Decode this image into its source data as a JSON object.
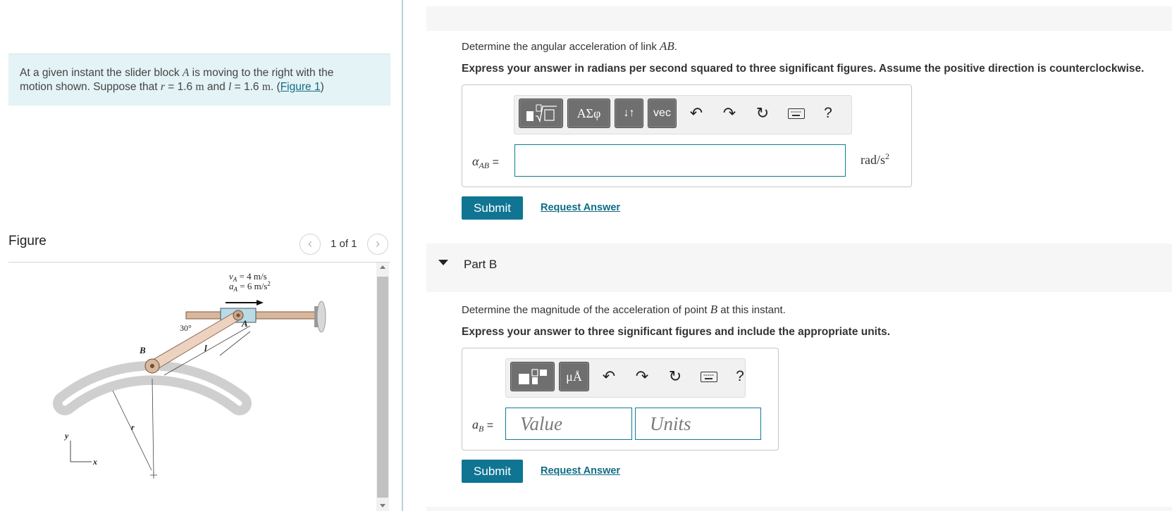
{
  "intro": {
    "text_before_A": "At a given instant the slider block ",
    "var_A": "A",
    "text_after_A": " is moving to the right with the",
    "line2_start": "motion shown. Suppose that ",
    "var_r": "r",
    "r_value": " = 1.6 ",
    "unit_m1": "m",
    "and_text": " and ",
    "var_l": "l",
    "l_value": " = 1.6 ",
    "unit_m2": "m",
    "period_paren": ". (",
    "figure_link": "Figure 1",
    "close_paren": ")"
  },
  "figure": {
    "title": "Figure",
    "counter": "1 of 1",
    "prev_icon": "chevron-left-icon",
    "next_icon": "chevron-right-icon",
    "labels": {
      "vA": "v",
      "vA_sub": "A",
      "vA_value": " = 4 m/s",
      "aA": "a",
      "aA_sub": "A",
      "aA_value": " = 6 m/s",
      "aA_exp": "2",
      "angle": "30°",
      "B": "B",
      "A": "A",
      "l": "l",
      "r": "r",
      "y": "y",
      "x": "x"
    }
  },
  "part_a": {
    "prompt_start": "Determine the angular acceleration of link ",
    "prompt_var": "AB",
    "prompt_end": ".",
    "instruction": "Express your answer in radians per second squared to three significant figures. Assume the positive direction is counterclockwise.",
    "toolbar": {
      "templates_icon": "fraction-sqrt-template-icon",
      "greek_label": "ΑΣφ",
      "arrows_label": "↓↑",
      "vec_label": "vec",
      "undo_icon": "undo-icon",
      "redo_icon": "redo-icon",
      "reset_icon": "reset-icon",
      "keyboard_icon": "keyboard-icon",
      "help_label": "?"
    },
    "var_symbol": "α",
    "var_sub": "AB",
    "equals": " =",
    "input_value": "",
    "unit": "rad/s",
    "unit_exp": "2",
    "submit_label": "Submit",
    "request_label": "Request Answer"
  },
  "part_b": {
    "header": "Part B",
    "caret_icon": "caret-down-icon",
    "prompt_start": "Determine the magnitude of the acceleration of point ",
    "prompt_var": "B",
    "prompt_end": " at this instant.",
    "instruction": "Express your answer to three significant figures and include the appropriate units.",
    "toolbar": {
      "templates_icon": "value-units-template-icon",
      "units_label": "μÅ",
      "undo_icon": "undo-icon",
      "redo_icon": "redo-icon",
      "reset_icon": "reset-icon",
      "keyboard_icon": "keyboard-icon",
      "help_label": "?"
    },
    "var_symbol": "a",
    "var_sub": "B",
    "equals": " =",
    "value_placeholder": "Value",
    "units_placeholder": "Units",
    "submit_label": "Submit",
    "request_label": "Request Answer"
  },
  "colors": {
    "accent": "#0f7593",
    "link": "#0f6c86",
    "intro_bg": "#e4f3f5",
    "toolbar_button": "#6f6f6f"
  }
}
